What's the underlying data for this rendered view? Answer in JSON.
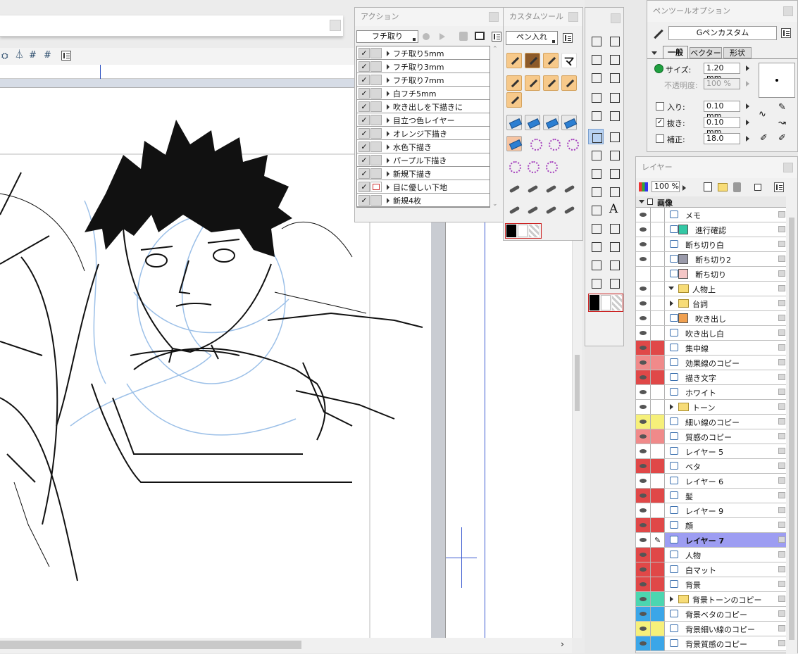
{
  "canvas_toolbar": {
    "icons": [
      "perspective-ruler-icon",
      "grid-icon",
      "grid-small-icon",
      "menu-icon"
    ]
  },
  "actions_panel": {
    "title": "アクション",
    "set_select": "フチ取り",
    "items": [
      {
        "label": "フチ取り5mm",
        "checked": true,
        "has_dialog": false
      },
      {
        "label": "フチ取り3mm",
        "checked": true,
        "has_dialog": false
      },
      {
        "label": "フチ取り7mm",
        "checked": true,
        "has_dialog": false
      },
      {
        "label": "白フチ5mm",
        "checked": true,
        "has_dialog": false
      },
      {
        "label": "吹き出しを下描きに",
        "checked": true,
        "has_dialog": false
      },
      {
        "label": "目立つ色レイヤー",
        "checked": true,
        "has_dialog": false
      },
      {
        "label": "オレンジ下描き",
        "checked": true,
        "has_dialog": false
      },
      {
        "label": "水色下描き",
        "checked": true,
        "has_dialog": false
      },
      {
        "label": "パープル下描き",
        "checked": true,
        "has_dialog": false
      },
      {
        "label": "新規下描き",
        "checked": true,
        "has_dialog": false
      },
      {
        "label": "目に優しい下地",
        "checked": true,
        "has_dialog": true
      },
      {
        "label": "新規4枚",
        "checked": true,
        "has_dialog": false
      }
    ]
  },
  "custom_tools_panel": {
    "title": "カスタムツール",
    "set_select": "ペン入れ"
  },
  "pen_options_panel": {
    "title": "ペンツールオプション",
    "preset": "Gペンカスタム",
    "tabs": [
      "一般",
      "ベクター",
      "形状"
    ],
    "size_label": "サイズ:",
    "size_value": "1.20 mm",
    "opacity_label": "不透明度:",
    "opacity_value": "100 %",
    "in_label": "入り:",
    "in_checked": false,
    "in_value": "0.10 mm",
    "out_label": "抜き:",
    "out_checked": true,
    "out_value": "0.10 mm",
    "correction_label": "補正:",
    "correction_checked": false,
    "correction_value": "18.0"
  },
  "layers_panel": {
    "title": "レイヤー",
    "opacity": "100 %",
    "root": "画像",
    "layers": [
      {
        "name": "メモ",
        "color": "#ffffff",
        "eye": true,
        "indent": 0,
        "icon": "page",
        "type": "layer"
      },
      {
        "name": "進行確認",
        "color": "#ffffff",
        "eye": true,
        "indent": 0,
        "icon": "teal",
        "type": "layer"
      },
      {
        "name": "断ち切り白",
        "color": "#ffffff",
        "eye": true,
        "indent": 0,
        "icon": "page",
        "type": "layer"
      },
      {
        "name": "断ち切り2",
        "color": "#ffffff",
        "eye": true,
        "indent": 0,
        "icon": "gray",
        "type": "layer"
      },
      {
        "name": "断ち切り",
        "color": "#ffffff",
        "eye": false,
        "indent": 0,
        "icon": "pink",
        "type": "layer"
      },
      {
        "name": "人物上",
        "color": "#ffffff",
        "eye": true,
        "indent": 0,
        "icon": "",
        "type": "folder-open"
      },
      {
        "name": "台詞",
        "color": "#ffffff",
        "eye": true,
        "indent": 1,
        "icon": "",
        "type": "folder"
      },
      {
        "name": "吹き出し",
        "color": "#ffffff",
        "eye": true,
        "indent": 0,
        "icon": "orange",
        "type": "layer"
      },
      {
        "name": "吹き出し白",
        "color": "#ffffff",
        "eye": true,
        "indent": 0,
        "icon": "page",
        "type": "layer"
      },
      {
        "name": "集中線",
        "color": "#e04848",
        "eye": true,
        "indent": 0,
        "icon": "page",
        "type": "layer"
      },
      {
        "name": "効果線のコピー",
        "color": "#f08a8a",
        "eye": true,
        "indent": 0,
        "icon": "page",
        "type": "layer"
      },
      {
        "name": "描き文字",
        "color": "#e04848",
        "eye": true,
        "indent": 0,
        "icon": "page",
        "type": "layer"
      },
      {
        "name": "ホワイト",
        "color": "#ffffff",
        "eye": true,
        "indent": 0,
        "icon": "page",
        "type": "layer"
      },
      {
        "name": "トーン",
        "color": "#ffffff",
        "eye": true,
        "indent": 0,
        "icon": "",
        "type": "folder"
      },
      {
        "name": "細い線のコピー",
        "color": "#f6f07a",
        "eye": true,
        "indent": 0,
        "icon": "page",
        "type": "layer"
      },
      {
        "name": "質感のコピー",
        "color": "#f08a8a",
        "eye": true,
        "indent": 0,
        "icon": "page",
        "type": "layer"
      },
      {
        "name": "レイヤー 5",
        "color": "#ffffff",
        "eye": true,
        "indent": 0,
        "icon": "page",
        "type": "layer"
      },
      {
        "name": "ベタ",
        "color": "#e04848",
        "eye": true,
        "indent": 0,
        "icon": "page",
        "type": "layer"
      },
      {
        "name": "レイヤー 6",
        "color": "#ffffff",
        "eye": true,
        "indent": 0,
        "icon": "page",
        "type": "layer"
      },
      {
        "name": "髪",
        "color": "#e04848",
        "eye": true,
        "indent": 0,
        "icon": "page",
        "type": "layer"
      },
      {
        "name": "レイヤー 9",
        "color": "#ffffff",
        "eye": true,
        "indent": 0,
        "icon": "page",
        "type": "layer"
      },
      {
        "name": "顔",
        "color": "#e04848",
        "eye": true,
        "indent": 0,
        "icon": "page",
        "type": "layer"
      },
      {
        "name": "レイヤー 7",
        "color": "#ffffff",
        "eye": true,
        "indent": 0,
        "icon": "page",
        "type": "layer",
        "selected": true
      },
      {
        "name": "人物",
        "color": "#e04848",
        "eye": true,
        "indent": 0,
        "icon": "page",
        "type": "layer"
      },
      {
        "name": "白マット",
        "color": "#e04848",
        "eye": true,
        "indent": 0,
        "icon": "page",
        "type": "layer"
      },
      {
        "name": "背景",
        "color": "#e04848",
        "eye": true,
        "indent": 0,
        "icon": "page",
        "type": "layer"
      },
      {
        "name": "背景トーンのコピー",
        "color": "#4cd6b0",
        "eye": true,
        "indent": 0,
        "icon": "",
        "type": "folder"
      },
      {
        "name": "背景ベタのコピー",
        "color": "#3ba6e8",
        "eye": true,
        "indent": 0,
        "icon": "page",
        "type": "layer"
      },
      {
        "name": "背景細い線のコピー",
        "color": "#f6f07a",
        "eye": true,
        "indent": 0,
        "icon": "page",
        "type": "layer"
      },
      {
        "name": "背景質感のコピー",
        "color": "#3ba6e8",
        "eye": true,
        "indent": 0,
        "icon": "page",
        "type": "layer"
      }
    ]
  }
}
